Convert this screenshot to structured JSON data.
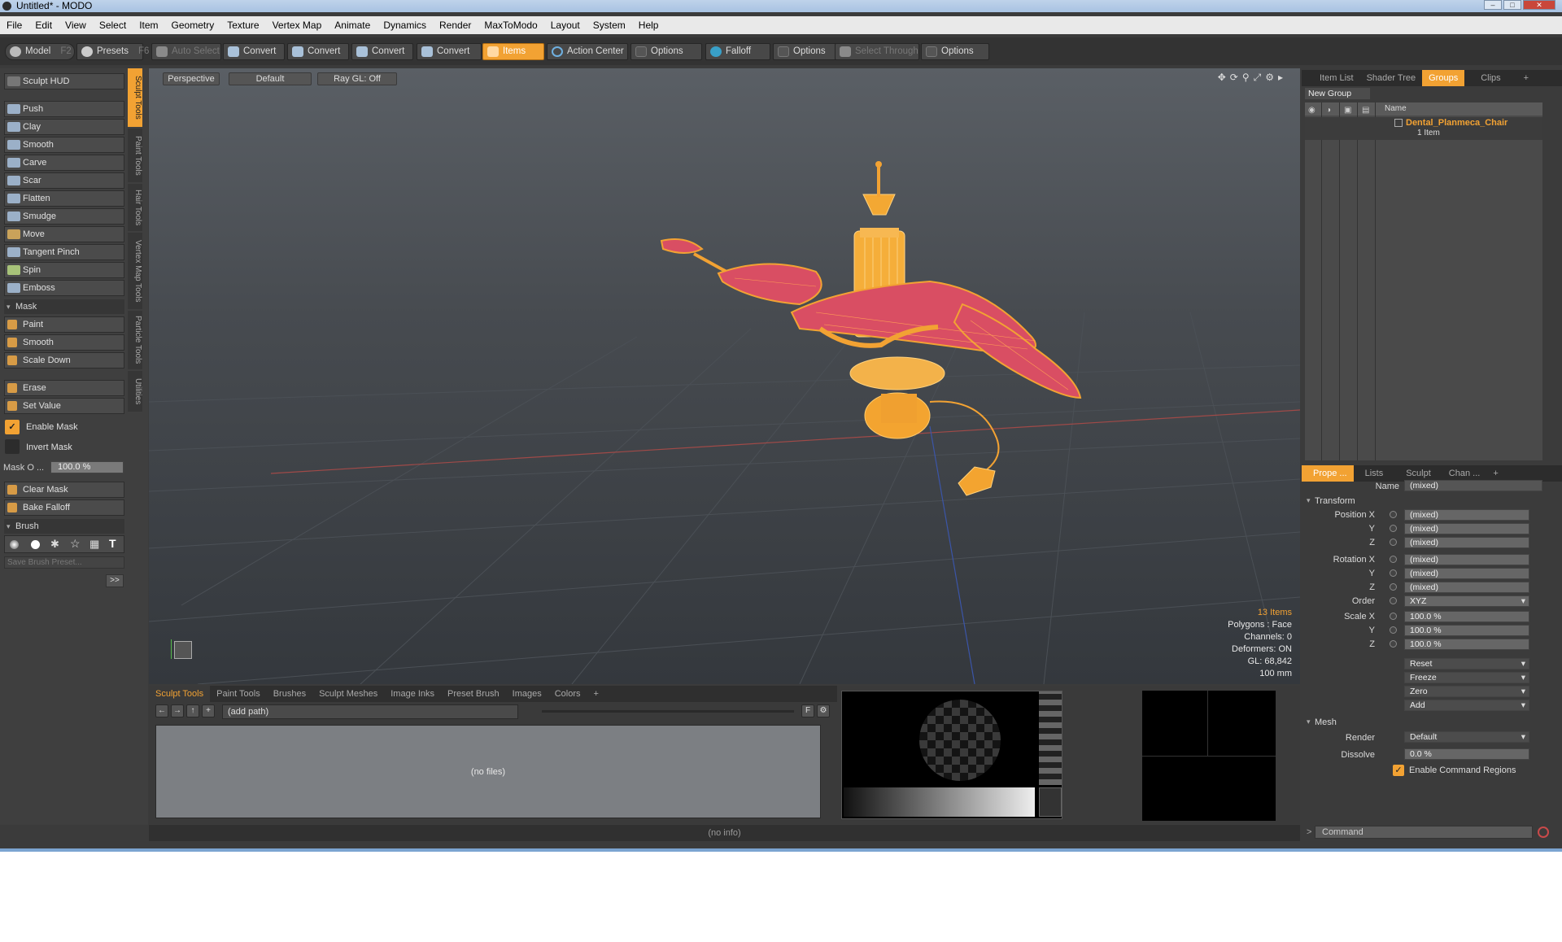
{
  "window": {
    "title": "Untitled* - MODO"
  },
  "menu": [
    "File",
    "Edit",
    "View",
    "Select",
    "Item",
    "Geometry",
    "Texture",
    "Vertex Map",
    "Animate",
    "Dynamics",
    "Render",
    "MaxToModo",
    "Layout",
    "System",
    "Help"
  ],
  "toolbar": {
    "model": "Model",
    "model_key": "F2",
    "presets": "Presets",
    "presets_key": "F6",
    "auto_select": "Auto Select",
    "convert": "Convert",
    "items": "Items",
    "action_center": "Action Center",
    "options": "Options",
    "falloff": "Falloff",
    "select_through": "Select Through"
  },
  "left": {
    "sculpt_hud": "Sculpt HUD",
    "tools": [
      "Push",
      "Clay",
      "Smooth",
      "Carve",
      "Scar",
      "Flatten",
      "Smudge",
      "Move",
      "Tangent Pinch",
      "Spin",
      "Emboss"
    ],
    "mask_section": "Mask",
    "mask_tools": [
      "Paint",
      "Smooth",
      "Scale Down"
    ],
    "erase": "Erase",
    "set_value": "Set Value",
    "enable_mask": "Enable Mask",
    "invert_mask": "Invert Mask",
    "mask_opacity_label": "Mask O ...",
    "mask_opacity_value": "100.0 %",
    "clear_mask": "Clear Mask",
    "bake_falloff": "Bake Falloff",
    "brush_section": "Brush",
    "save_brush": "Save Brush Preset...",
    "more": ">>",
    "side_tabs": [
      "Sculpt Tools",
      "Paint Tools",
      "Hair Tools",
      "Vertex Map Tools",
      "Particle Tools",
      "Utilities"
    ]
  },
  "viewport": {
    "view": "Perspective",
    "shading": "Default",
    "raygl": "Ray GL: Off",
    "info": {
      "items": "13 Items",
      "polygons": "Polygons : Face",
      "channels": "Channels: 0",
      "deformers": "Deformers: ON",
      "gl": "GL: 68,842",
      "scale": "100 mm"
    }
  },
  "bottom": {
    "tabs": [
      "Sculpt Tools",
      "Paint Tools",
      "Brushes",
      "Sculpt Meshes",
      "Image Inks",
      "Preset Brush",
      "Images",
      "Colors",
      "+"
    ],
    "path": "(add path)",
    "no_files": "(no files)",
    "status": "(no info)"
  },
  "right": {
    "top_tabs": [
      "Item List",
      "Shader Tree",
      "Groups",
      "Clips",
      "+"
    ],
    "new_group": "New Group",
    "col_name": "Name",
    "group_name": "Dental_Planmeca_Chair",
    "group_sub": "1 Item",
    "prop_tabs": [
      "Prope ...",
      "Lists",
      "Sculpt",
      "Chan ...",
      "+"
    ],
    "name_label": "Name",
    "name_value": "(mixed)",
    "transform": "Transform",
    "position_label": "Position X",
    "rotation_label": "Rotation X",
    "scale_label": "Scale X",
    "y": "Y",
    "z": "Z",
    "mixed": "(mixed)",
    "order_label": "Order",
    "order_value": "XYZ",
    "scale_value": "100.0 %",
    "reset": "Reset",
    "freeze": "Freeze",
    "zero": "Zero",
    "add": "Add",
    "mesh": "Mesh",
    "render_label": "Render",
    "render_value": "Default",
    "dissolve_label": "Dissolve",
    "dissolve_value": "0.0 %",
    "enable_cmd_regions": "Enable Command Regions",
    "command": "Command"
  }
}
